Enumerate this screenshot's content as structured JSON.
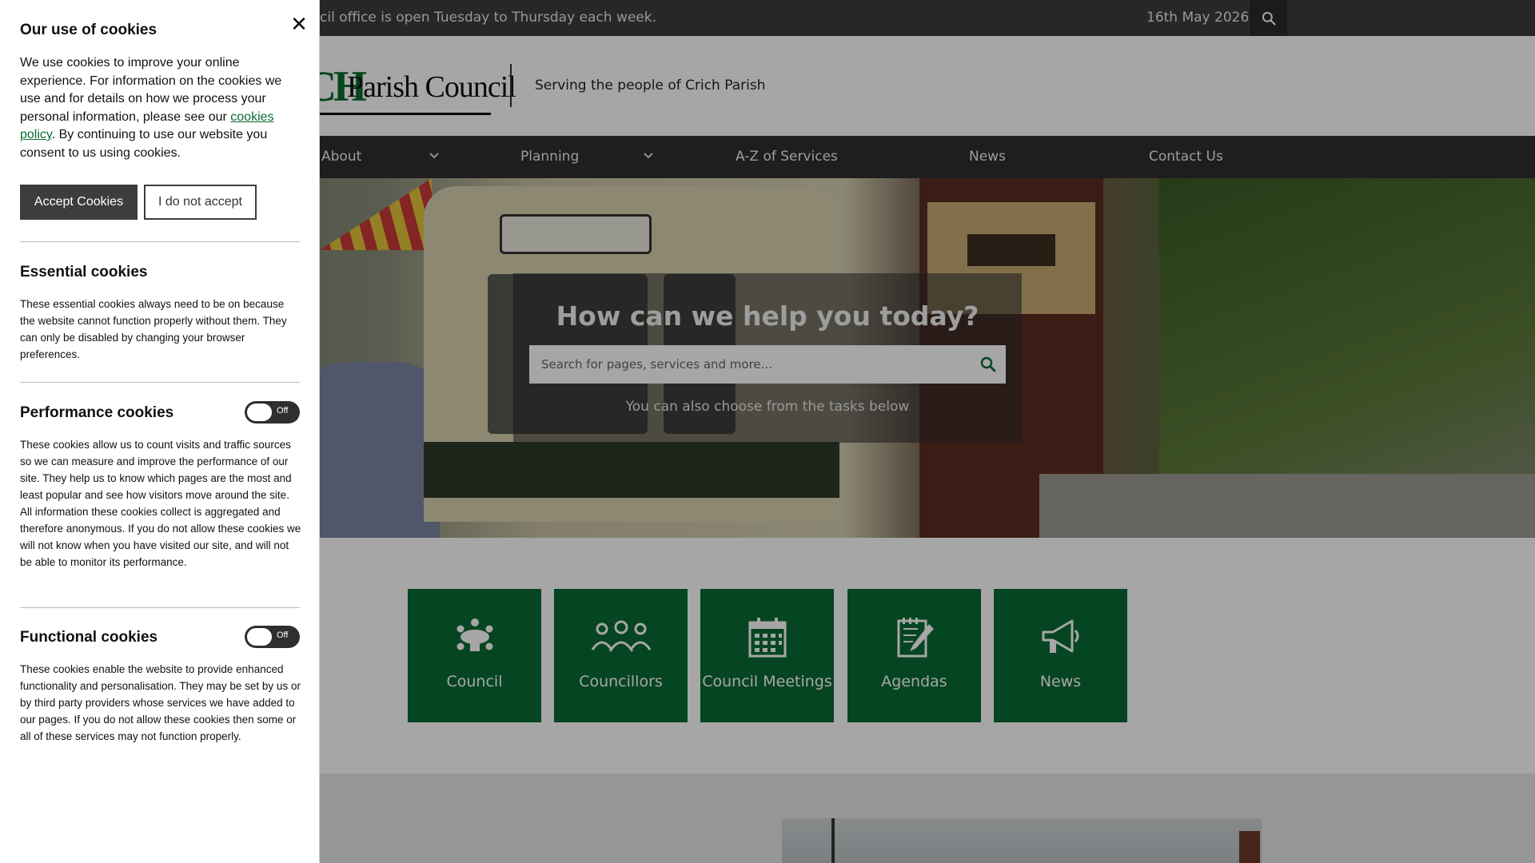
{
  "topbar": {
    "notice": "cil office is open Tuesday to Thursday each week.",
    "date": "16th May 2026",
    "search_icon": "search-icon"
  },
  "header": {
    "logo_text": "Parish Council",
    "logo_mark": "CH",
    "tagline": "Serving the people of Crich Parish"
  },
  "nav": {
    "items": [
      {
        "label": "About",
        "has_dropdown": true
      },
      {
        "label": "Planning",
        "has_dropdown": true
      },
      {
        "label": "A-Z of Services",
        "has_dropdown": false
      },
      {
        "label": "News",
        "has_dropdown": false
      },
      {
        "label": "Contact Us",
        "has_dropdown": false
      }
    ]
  },
  "hero": {
    "title": "How can we help you today?",
    "search_placeholder": "Search for pages, services and more...",
    "subtitle": "You can also choose from the tasks below"
  },
  "tiles": [
    {
      "label": "Council",
      "icon": "meeting-table-icon"
    },
    {
      "label": "Councillors",
      "icon": "people-icon"
    },
    {
      "label": "Council Meetings",
      "icon": "calendar-icon"
    },
    {
      "label": "Agendas",
      "icon": "document-edit-icon"
    },
    {
      "label": "News",
      "icon": "megaphone-icon"
    }
  ],
  "cookie": {
    "title": "Our use of cookies",
    "close_icon": "close-icon",
    "intro_before_link": "We use cookies to improve your online experience. For information on the cookies we use and for details on how we process your personal information, please see our ",
    "intro_link": "cookies policy",
    "intro_after_link": ". By continuing to use our website you consent to us using cookies.",
    "accept_label": "Accept Cookies",
    "reject_label": "I do not accept",
    "sections": [
      {
        "heading": "Essential cookies",
        "has_toggle": false,
        "text": "These essential cookies always need to be on because the website cannot function properly without them. They can only be disabled by changing your browser preferences."
      },
      {
        "heading": "Performance cookies",
        "has_toggle": true,
        "toggle_state": "Off",
        "text": "These cookies allow us to count visits and traffic sources so we can measure and improve the performance of our site. They help us to know which pages are the most and least popular and see how visitors move around the site. All information these cookies collect is aggregated and therefore anonymous. If you do not allow these cookies we will not know when you have visited our site, and will not be able to monitor its performance."
      },
      {
        "heading": "Functional cookies",
        "has_toggle": true,
        "toggle_state": "Off",
        "text": "These cookies enable the website to provide enhanced functionality and personalisation. They may be set by us or by third party providers whose services we have added to our pages. If you do not allow these cookies then some or all of these services may not function properly."
      }
    ]
  },
  "colors": {
    "brand_green": "#0a6b34",
    "topbar": "#3d3d3d",
    "nav": "#2f2f2f"
  }
}
